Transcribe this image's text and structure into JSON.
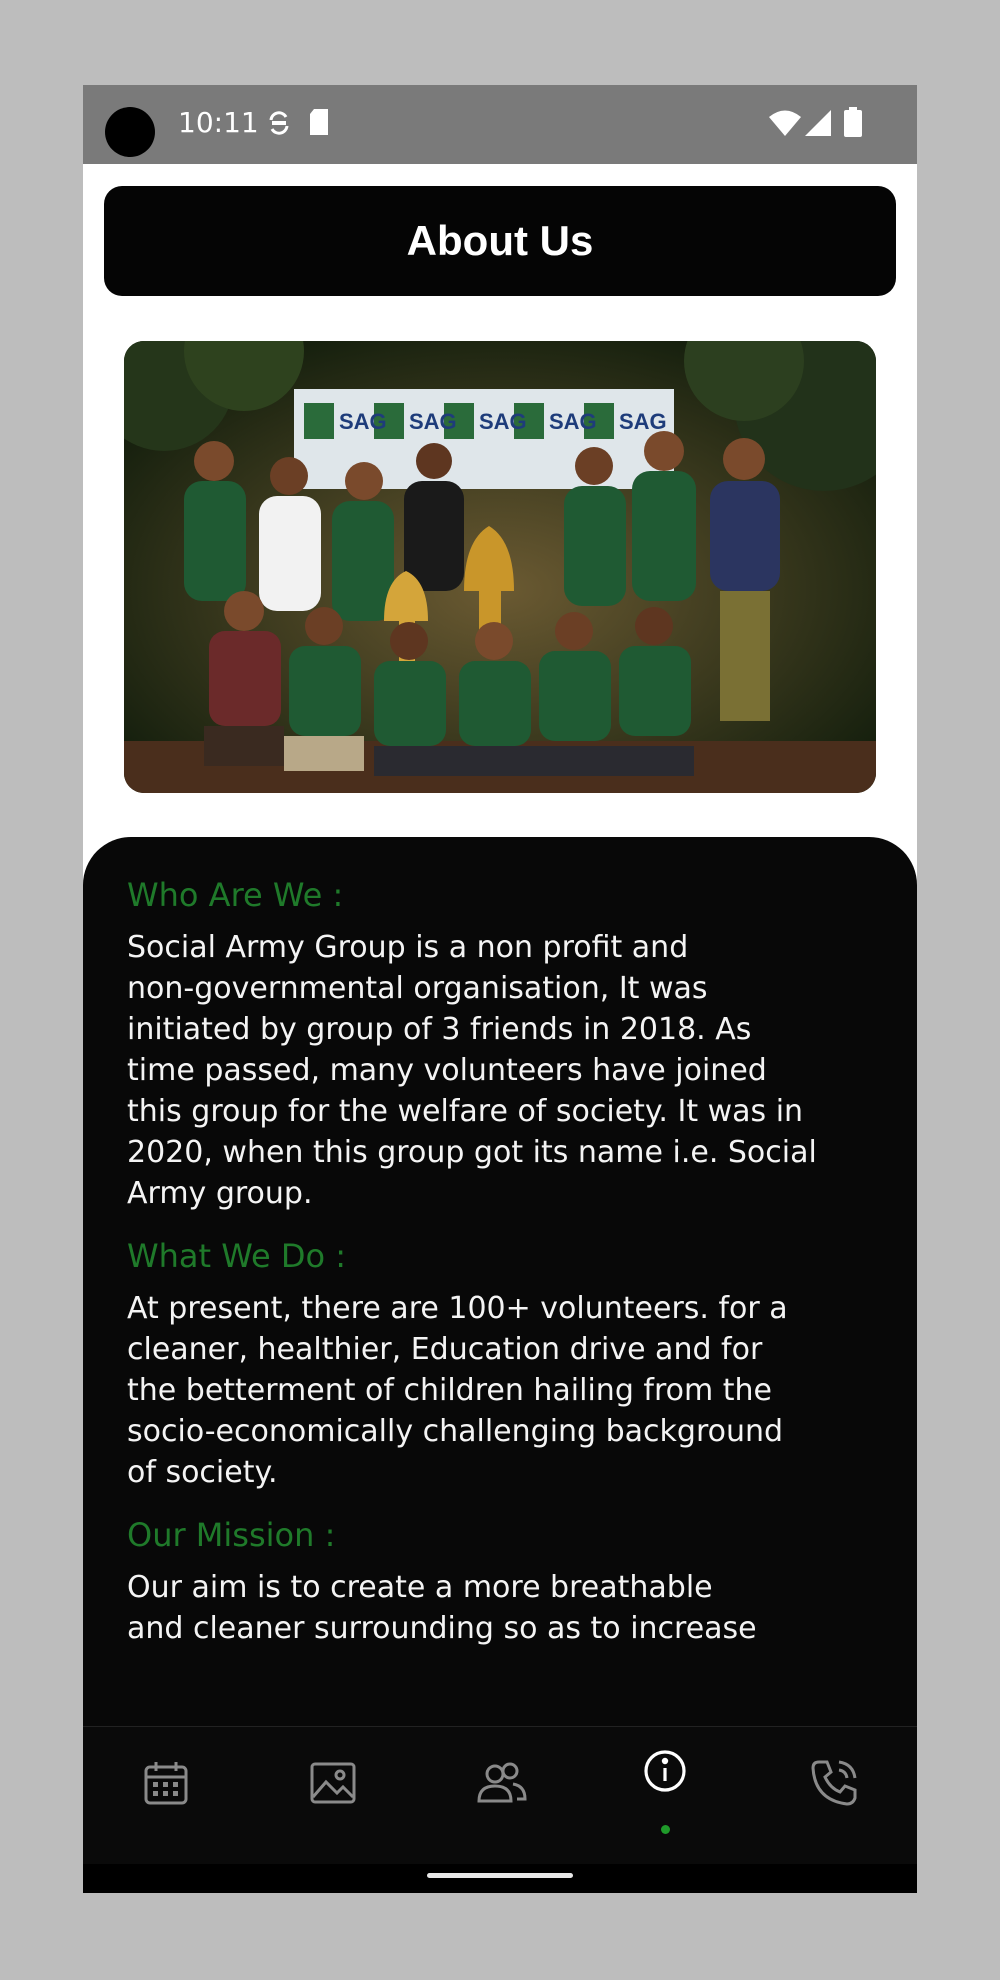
{
  "status_bar": {
    "time": "10:11"
  },
  "header": {
    "title": "About Us"
  },
  "photo": {
    "banner_text": "SAG"
  },
  "sections": [
    {
      "heading": "Who Are We :",
      "body": "Social Army Group  is a non profit and\nnon-governmental organisation, It was\ninitiated by group of 3 friends in 2018. As\ntime passed, many volunteers have joined\nthis group for the welfare of society. It was in\n2020, when this group got its name i.e. Social\nArmy group."
    },
    {
      "heading": "What We Do :",
      "body": "At present, there are 100+ volunteers. for a\ncleaner, healthier, Education drive and for\nthe betterment of children hailing from the\nsocio-economically challenging background\nof society."
    },
    {
      "heading": "Our Mission :",
      "body": "Our aim is to create a more breathable\nand cleaner surrounding so as to increase"
    }
  ],
  "nav": {
    "items": [
      "calendar-icon",
      "gallery-icon",
      "members-icon",
      "info-icon",
      "phone-icon"
    ],
    "active": "info-icon",
    "active_color": "#1f9a2a"
  },
  "colors": {
    "heading": "#1f7a2a",
    "panel": "#080808",
    "header_bg": "#050505"
  }
}
